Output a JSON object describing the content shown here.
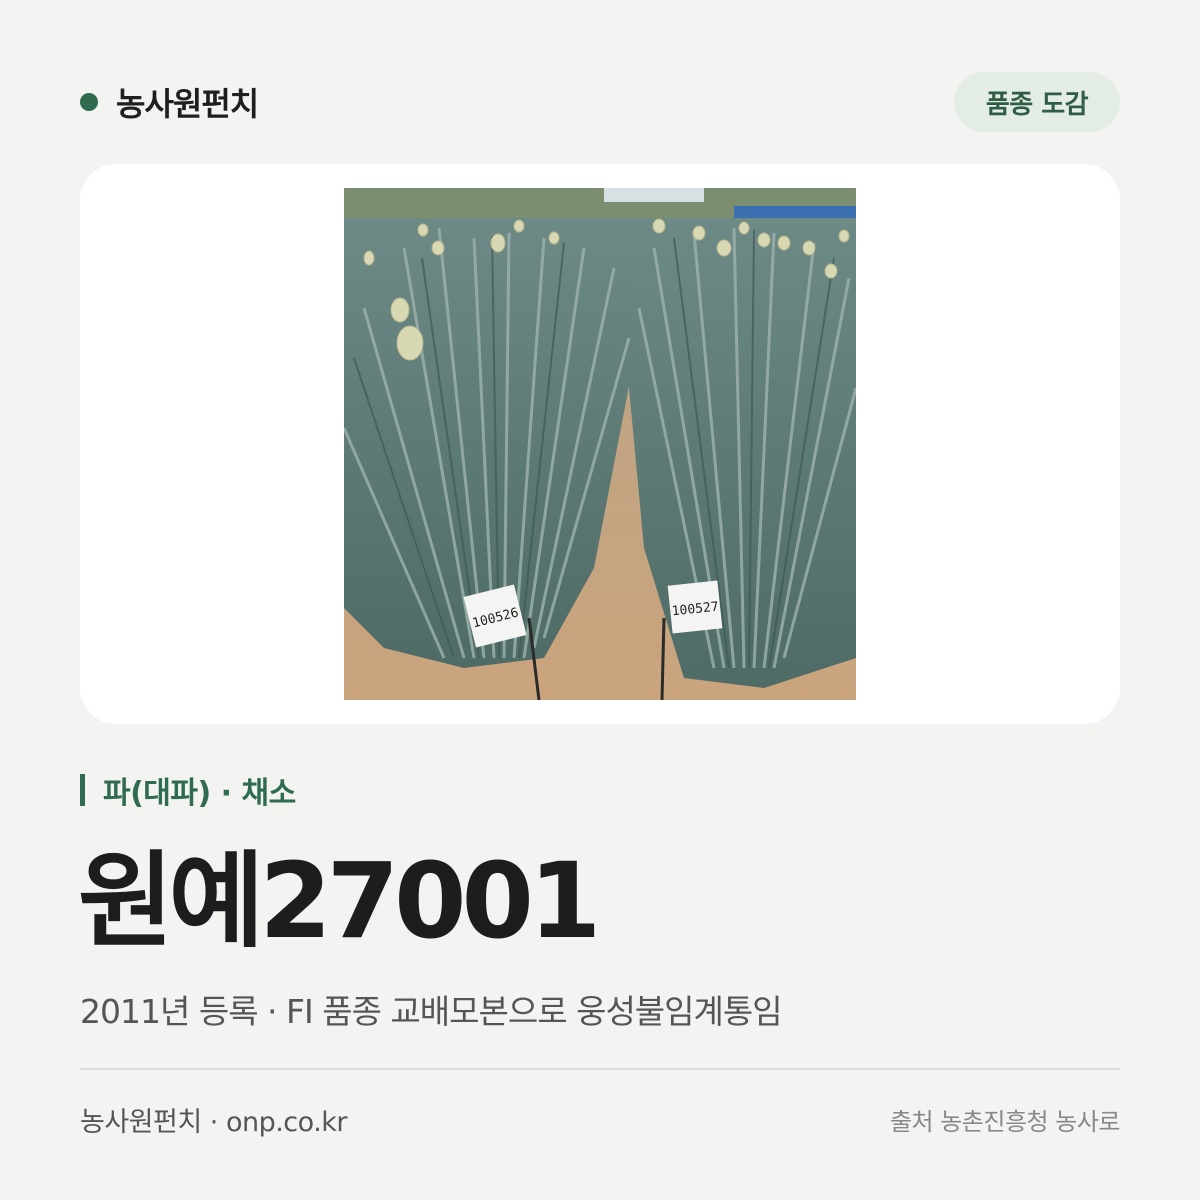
{
  "header": {
    "brand_name": "농사원펀치",
    "badge_label": "품종 도감"
  },
  "photo": {
    "tag_left": "100526",
    "tag_right": "100527"
  },
  "variety": {
    "category": "파(대파) · 채소",
    "name": "원예27001",
    "description": "2011년 등록 · FI 품종 교배모본으로 웅성불임계통임"
  },
  "footer": {
    "site": "농사원펀치 · onp.co.kr",
    "source": "출처 농촌진흥청 농사로"
  },
  "colors": {
    "accent": "#2f6b4e",
    "background": "#f3f3f1",
    "badge_bg": "#e3ece5"
  }
}
